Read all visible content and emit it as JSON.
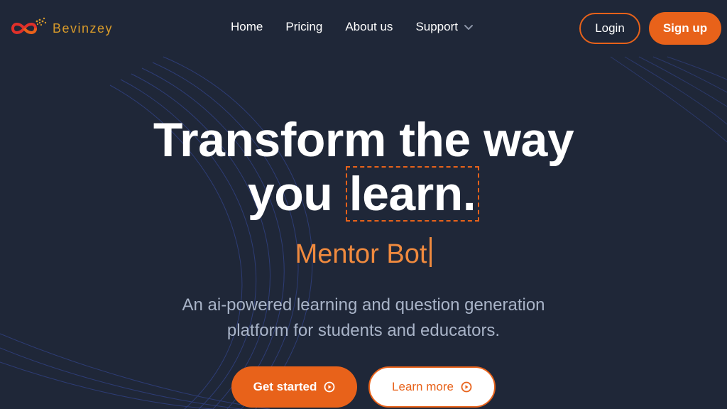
{
  "brand": {
    "name": "Bevinzey",
    "accent": "#e8621a",
    "logo_text_color": "#d79a2a",
    "background": "#1f2738"
  },
  "nav": {
    "items": [
      {
        "label": "Home"
      },
      {
        "label": "Pricing"
      },
      {
        "label": "About us"
      },
      {
        "label": "Support"
      }
    ],
    "login_label": "Login",
    "signup_label": "Sign up"
  },
  "hero": {
    "title_line1": "Transform the way",
    "title_line2_prefix": "you",
    "title_highlight": "learn.",
    "typing_text": "Mentor Bot",
    "subtitle": "An ai-powered learning and question generation platform for students and educators.",
    "cta_primary": "Get started",
    "cta_secondary": "Learn more"
  },
  "icons": {
    "logo": "infinity-logo-icon",
    "support_dropdown": "chevron-down-icon",
    "cta_primary_icon": "play-circle-icon",
    "cta_secondary_icon": "play-circle-icon"
  }
}
